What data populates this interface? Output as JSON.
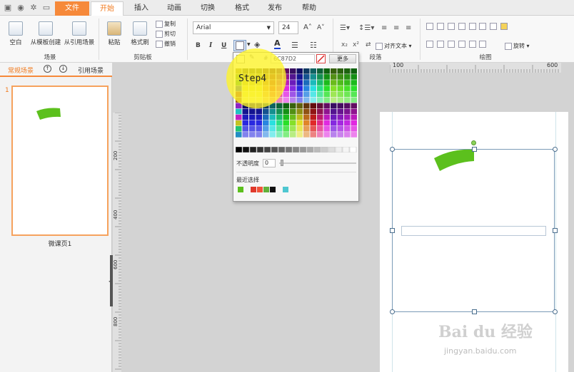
{
  "tabs": {
    "file": "文件",
    "home": "开始",
    "insert": "插入",
    "animation": "动画",
    "transition": "切换",
    "format": "格式",
    "publish": "发布",
    "help": "帮助"
  },
  "ribbon": {
    "scene_group": {
      "label": "场景",
      "blank": "空白",
      "from_template": "从模板创建",
      "from_reference": "从引用场景"
    },
    "clipboard_group": {
      "label": "剪贴板",
      "paste": "粘贴",
      "format_painter": "格式刷",
      "copy": "复制",
      "cut": "剪切",
      "undo": "撤销"
    },
    "font": {
      "family": "Arial",
      "size": "24",
      "bold": "B",
      "italic": "I",
      "underline": "U"
    },
    "paragraph_group": {
      "label": "段落",
      "align_text": "对齐文本"
    },
    "drawing_group": {
      "label": "绘图",
      "rotate": "旋转"
    }
  },
  "color_picker": {
    "hex_value": "6C87D2",
    "more_button": "更多",
    "opacity_label": "不透明度",
    "opacity_value": "0",
    "recent_label": "最近选择",
    "recent_colors": [
      "#5cc01d",
      "#e03a2c",
      "#f0543a",
      "#62b13a",
      "#111111",
      "#4fc7d1"
    ],
    "gray_row": [
      "#000000",
      "#111111",
      "#222222",
      "#333333",
      "#444444",
      "#555555",
      "#666666",
      "#777777",
      "#888888",
      "#999999",
      "#aaaaaa",
      "#bbbbbb",
      "#cccccc",
      "#dddddd",
      "#eeeeee",
      "#f5f5f5",
      "#ffffff"
    ]
  },
  "overlay": {
    "step_label": "Step4"
  },
  "left_panel": {
    "tab_regular": "常规场景",
    "tab_reference": "引用场景",
    "slide_number": "1",
    "slide_caption": "微课页1"
  },
  "ruler": {
    "h_labels": [
      "100",
      "200",
      "300",
      "400",
      "500",
      "600"
    ],
    "v_labels": [
      "100",
      "200",
      "300",
      "400",
      "500",
      "600",
      "700",
      "800"
    ]
  },
  "watermark": {
    "line1": "Bai du 经验",
    "line2": "jingyan.baidu.com"
  },
  "colors": {
    "accent": "#f6893a",
    "shape_green": "#5cc01d",
    "selection": "#7a9bb7"
  }
}
